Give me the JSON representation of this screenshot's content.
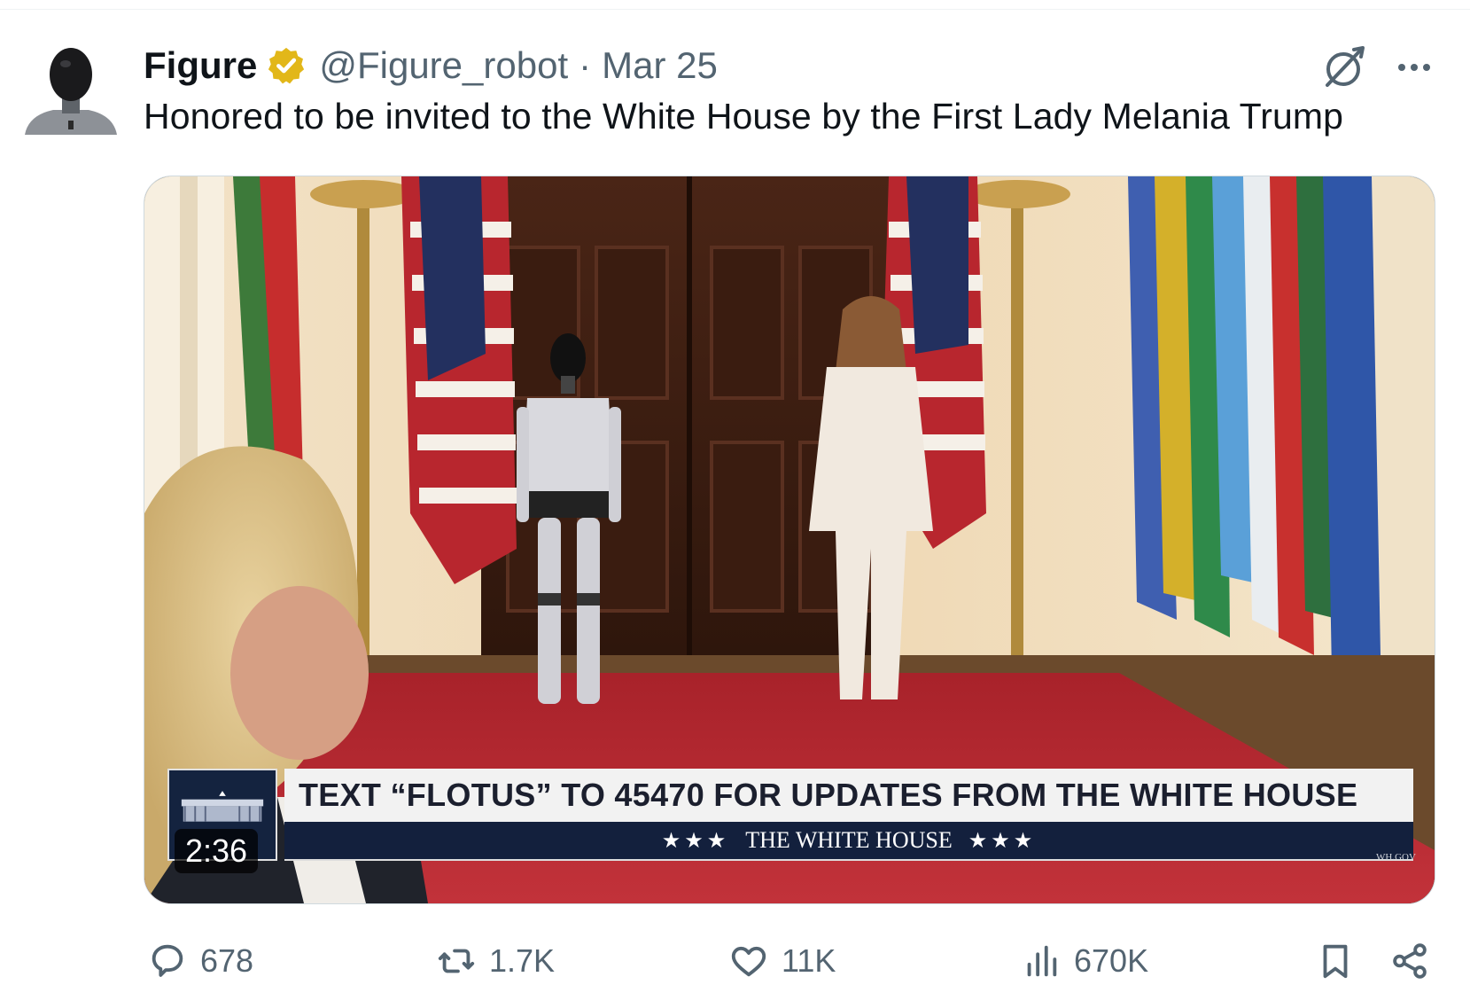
{
  "tweet": {
    "display_name": "Figure",
    "handle": "@Figure_robot",
    "separator": "·",
    "date": "Mar 25",
    "text": "Honored to be invited to the White House by the First Lady Melania Trump",
    "verified_color": "#e2b719",
    "avatar_icon": "humanoid-robot-avatar"
  },
  "header_icons": {
    "grok": "grok-icon",
    "more": "more-icon"
  },
  "video": {
    "duration": "2:36",
    "lower_third": "TEXT “FLOTUS” TO 45470 FOR UPDATES FROM THE WHITE HOUSE",
    "banner_stars_left": "★★★",
    "banner_text": "THE WHITE HOUSE",
    "banner_stars_right": "★★★",
    "watermark": "WH.GOV"
  },
  "metrics": {
    "replies": "678",
    "reposts": "1.7K",
    "likes": "11K",
    "views": "670K"
  },
  "colors": {
    "secondary_text": "#536471",
    "banner_navy": "#13203d",
    "carpet_red": "#b3242b"
  }
}
